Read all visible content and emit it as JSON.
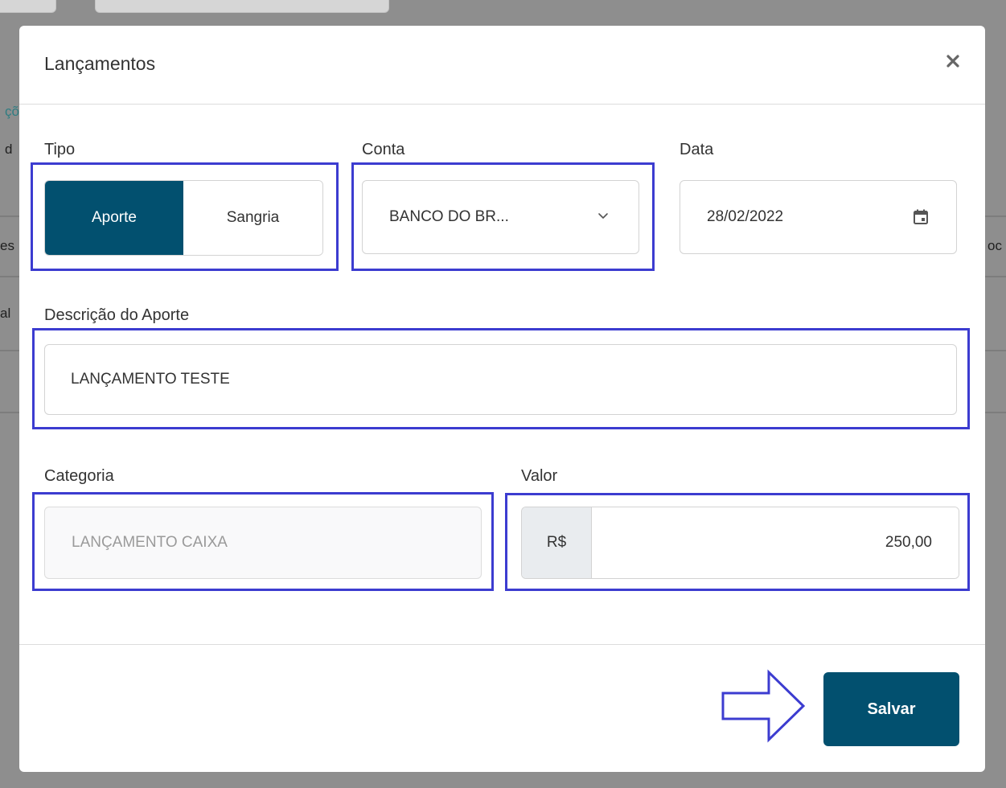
{
  "background": {
    "fragments": [
      "çõ",
      "d",
      "es",
      "al",
      "oc"
    ]
  },
  "modal": {
    "title": "Lançamentos",
    "close_icon": "close-icon"
  },
  "form": {
    "tipo": {
      "label": "Tipo",
      "options": [
        "Aporte",
        "Sangria"
      ],
      "selected": "Aporte"
    },
    "conta": {
      "label": "Conta",
      "value": "BANCO DO BR...",
      "icon": "chevron-down-icon"
    },
    "data": {
      "label": "Data",
      "value": "28/02/2022",
      "icon": "calendar-icon"
    },
    "descricao": {
      "label": "Descrição do Aporte",
      "value": "LANÇAMENTO TESTE"
    },
    "categoria": {
      "label": "Categoria",
      "value": "LANÇAMENTO CAIXA"
    },
    "valor": {
      "label": "Valor",
      "prefix": "R$",
      "value": "250,00"
    }
  },
  "footer": {
    "save_label": "Salvar"
  },
  "colors": {
    "primary": "#02506f",
    "highlight": "#3c3cd0",
    "overlay": "#8e8e8e"
  }
}
